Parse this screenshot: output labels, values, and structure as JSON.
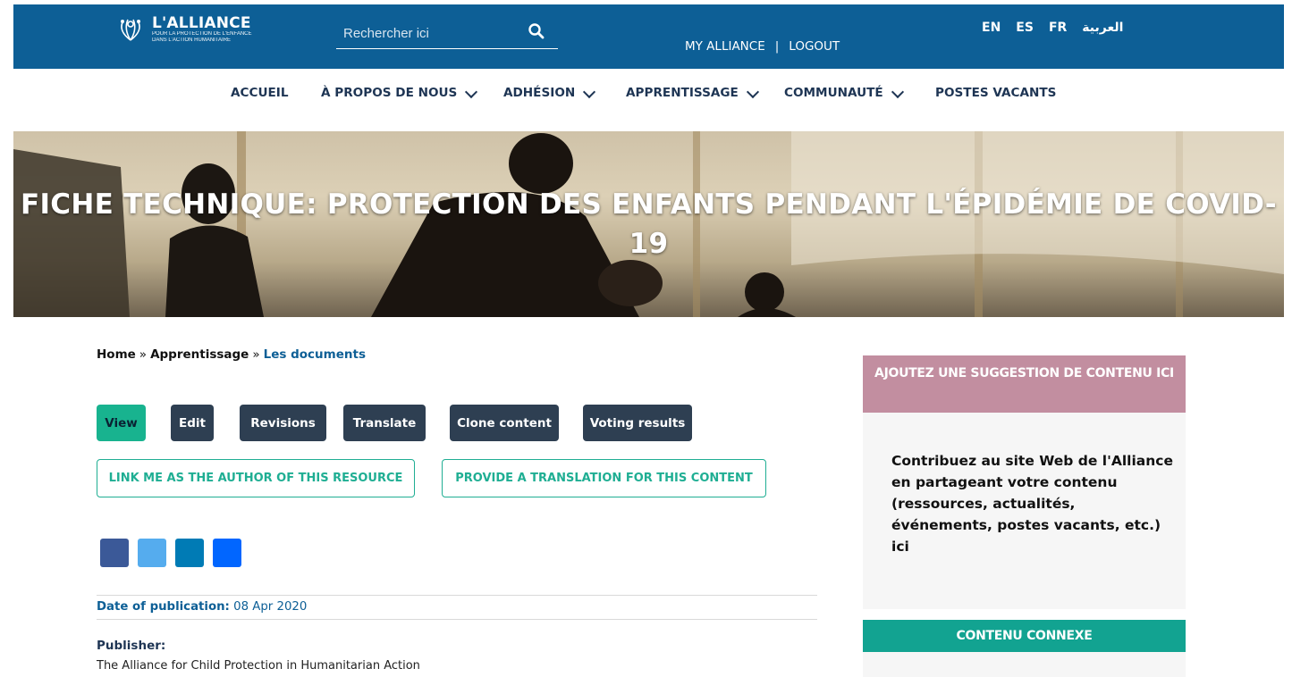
{
  "header": {
    "logo_title": "L'ALLIANCE",
    "logo_subtitle_1": "POUR LA PROTECTION DE L'ENFANCE",
    "logo_subtitle_2": "DANS L'ACTION HUMANITAIRE",
    "search_placeholder": "Rechercher ici",
    "my_alliance": "MY ALLIANCE",
    "separator": "|",
    "logout": "LOGOUT",
    "languages": [
      "EN",
      "ES",
      "FR",
      "العربية"
    ],
    "bar_color": "#0d5f96"
  },
  "nav": {
    "items": [
      {
        "label": "ACCUEIL",
        "dropdown": false
      },
      {
        "label": "À PROPOS DE NOUS",
        "dropdown": true
      },
      {
        "label": "ADHÉSION",
        "dropdown": true
      },
      {
        "label": "APPRENTISSAGE",
        "dropdown": true
      },
      {
        "label": "COMMUNAUTÉ",
        "dropdown": true
      },
      {
        "label": "POSTES VACANTS",
        "dropdown": false
      }
    ]
  },
  "hero": {
    "title": "FICHE TECHNIQUE: PROTECTION DES ENFANTS PENDANT L'ÉPIDÉMIE DE COVID-19"
  },
  "breadcrumb": {
    "items": [
      "Home",
      "Apprentissage",
      "Les documents"
    ],
    "separator": "»"
  },
  "tabs": [
    {
      "label": "View",
      "active": true
    },
    {
      "label": "Edit",
      "active": false
    },
    {
      "label": "Revisions",
      "active": false
    },
    {
      "label": "Translate",
      "active": false
    },
    {
      "label": "Clone content",
      "active": false
    },
    {
      "label": "Voting results",
      "active": false
    }
  ],
  "actions": {
    "link_author": "LINK ME AS THE AUTHOR OF THIS RESOURCE",
    "provide_translation": "PROVIDE A TRANSLATION FOR THIS CONTENT"
  },
  "share": [
    {
      "icon": "facebook-icon",
      "color": "#3b5998"
    },
    {
      "icon": "twitter-icon",
      "color": "#55acee"
    },
    {
      "icon": "linkedin-icon",
      "color": "#007bb5"
    },
    {
      "icon": "share-icon",
      "color": "#0166ff"
    }
  ],
  "meta": {
    "date_label": "Date of publication:",
    "date_value": "08 Apr 2020",
    "publisher_label": "Publisher:",
    "publisher_value": "The Alliance for Child Protection in Humanitarian Action"
  },
  "sidebar": {
    "suggest_title": "AJOUTEZ UNE SUGGESTION DE CONTENU ICI",
    "suggest_text": "Contribuez au site Web de l'Alliance en partageant votre contenu (ressources, actualités, événements, postes vacants, etc.) ici",
    "related_title": "CONTENU CONNEXE",
    "suggest_color": "#c28ea0",
    "related_color": "#12a391"
  }
}
